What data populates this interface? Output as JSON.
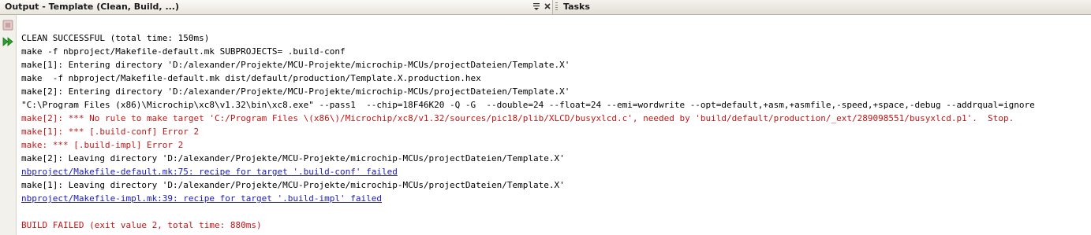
{
  "tabs": {
    "output_title": "Output - Template (Clean, Build, ...)",
    "tasks_title": "Tasks",
    "menu_icon": "window-menu-icon",
    "close_icon": "close-icon"
  },
  "sidebar": {
    "stop_icon": "stop-icon",
    "rerun_icon": "rerun-icon"
  },
  "console": {
    "lines": [
      {
        "text": "CLEAN SUCCESSFUL (total time: 150ms)",
        "style": "normal"
      },
      {
        "text": "make -f nbproject/Makefile-default.mk SUBPROJECTS= .build-conf",
        "style": "normal"
      },
      {
        "text": "make[1]: Entering directory 'D:/alexander/Projekte/MCU-Projekte/microchip-MCUs/projectDateien/Template.X'",
        "style": "normal"
      },
      {
        "text": "make  -f nbproject/Makefile-default.mk dist/default/production/Template.X.production.hex",
        "style": "normal"
      },
      {
        "text": "make[2]: Entering directory 'D:/alexander/Projekte/MCU-Projekte/microchip-MCUs/projectDateien/Template.X'",
        "style": "normal"
      },
      {
        "text": "\"C:\\Program Files (x86)\\Microchip\\xc8\\v1.32\\bin\\xc8.exe\" --pass1  --chip=18F46K20 -Q -G  --double=24 --float=24 --emi=wordwrite --opt=default,+asm,+asmfile,-speed,+space,-debug --addrqual=ignore",
        "style": "normal"
      },
      {
        "text": "make[2]: *** No rule to make target 'C:/Program Files \\(x86\\)/Microchip/xc8/v1.32/sources/pic18/plib/XLCD/busyxlcd.c', needed by 'build/default/production/_ext/289098551/busyxlcd.p1'.  Stop.",
        "style": "error"
      },
      {
        "text": "make[1]: *** [.build-conf] Error 2",
        "style": "error"
      },
      {
        "text": "make: *** [.build-impl] Error 2",
        "style": "error"
      },
      {
        "text": "make[2]: Leaving directory 'D:/alexander/Projekte/MCU-Projekte/microchip-MCUs/projectDateien/Template.X'",
        "style": "normal"
      },
      {
        "text": "nbproject/Makefile-default.mk:75: recipe for target '.build-conf' failed",
        "style": "link"
      },
      {
        "text": "make[1]: Leaving directory 'D:/alexander/Projekte/MCU-Projekte/microchip-MCUs/projectDateien/Template.X'",
        "style": "normal"
      },
      {
        "text": "nbproject/Makefile-impl.mk:39: recipe for target '.build-impl' failed",
        "style": "link"
      },
      {
        "text": "",
        "style": "blank"
      },
      {
        "text": "BUILD FAILED (exit value 2, total time: 880ms)",
        "style": "error"
      }
    ]
  },
  "colors": {
    "error": "#c01818",
    "link": "#1b1bb8",
    "normal": "#000000"
  }
}
